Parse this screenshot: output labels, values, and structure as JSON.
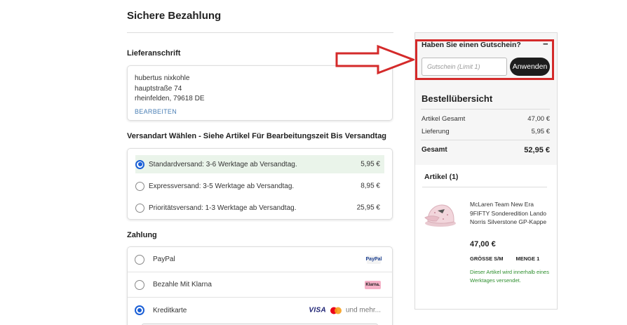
{
  "page": {
    "title": "Sichere Bezahlung"
  },
  "address": {
    "heading": "Lieferanschrift",
    "lines": [
      "hubertus nixkohle",
      "hauptstraße 74",
      "rheinfelden, 79618 DE"
    ],
    "edit_label": "BEARBEITEN"
  },
  "shipping": {
    "heading": "Versandart Wählen - Siehe Artikel Für Bearbeitungszeit Bis Versandtag",
    "options": [
      {
        "label": "Standardversand: 3-6 Werktage ab Versandtag.",
        "price": "5,95 €",
        "selected": true
      },
      {
        "label": "Expressversand: 3-5 Werktage ab Versandtag.",
        "price": "8,95 €",
        "selected": false
      },
      {
        "label": "Prioritätsversand: 1-3 Werktage ab Versandtag.",
        "price": "25,95 €",
        "selected": false
      }
    ]
  },
  "payment": {
    "heading": "Zahlung",
    "options": [
      {
        "label": "PayPal",
        "logo": "PayPal",
        "selected": false
      },
      {
        "label": "Bezahle Mit Klarna",
        "logo": "Klarna.",
        "selected": false
      },
      {
        "label": "Kreditkarte",
        "logo": "VISA",
        "more": "und mehr...",
        "selected": true
      }
    ]
  },
  "voucher": {
    "title": "Haben Sie einen Gutschein?",
    "collapse": "−",
    "placeholder": "Gutschein (Limit 1)",
    "apply_label": "Anwenden"
  },
  "summary": {
    "title": "Bestellübersicht",
    "subtotal_label": "Artikel Gesamt",
    "subtotal_value": "47,00 €",
    "shipping_label": "Lieferung",
    "shipping_value": "5,95 €",
    "total_label": "Gesamt",
    "total_value": "52,95 €"
  },
  "items": {
    "title": "Artikel (1)",
    "product": {
      "name": "McLaren Team New Era 9FIFTY Sonderedition Lando Norris Silverstone GP-Kappe",
      "price": "47,00 €",
      "size": "GRÖSSE S/M",
      "quantity": "MENGE 1",
      "note": "Dieser Artikel wird innerhalb eines Werktages versendet."
    }
  },
  "colors": {
    "accent_radio": "#1a5fd6",
    "highlight_box": "#d42a2a",
    "selected_row_bg": "#eaf4ea",
    "note_green": "#2f8f2f",
    "button_dark": "#1d1d1d"
  },
  "icons": [
    "arrow-right-icon",
    "radio-checked-icon",
    "radio-unchecked-icon",
    "paypal-logo-icon",
    "klarna-logo-icon",
    "visa-logo-icon",
    "mastercard-logo-icon",
    "cap-product-image"
  ]
}
